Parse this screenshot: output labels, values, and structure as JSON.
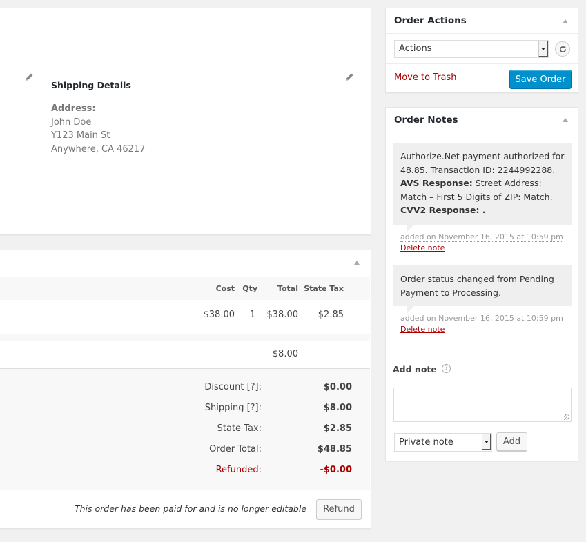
{
  "order_data": {
    "shipping": {
      "title": "Shipping Details",
      "address_label": "Address:",
      "address_lines": [
        "John Doe",
        "Y123 Main St",
        "Anywhere, CA 46217"
      ]
    }
  },
  "items": {
    "columns": [
      "Cost",
      "Qty",
      "Total",
      "State Tax"
    ],
    "line_items": [
      {
        "cost": "$38.00",
        "qty": "1",
        "total": "$38.00",
        "tax": "$2.85"
      }
    ],
    "shipping_line": {
      "total": "$8.00",
      "tax": "–"
    },
    "totals": [
      {
        "label": "Discount [?]:",
        "value": "$0.00"
      },
      {
        "label": "Shipping [?]:",
        "value": "$8.00"
      },
      {
        "label": "State Tax:",
        "value": "$2.85"
      },
      {
        "label": "Order Total:",
        "value": "$48.85"
      },
      {
        "label": "Refunded:",
        "value": "-$0.00"
      }
    ],
    "paid_note": "This order has been paid for and is no longer editable",
    "refund_label": "Refund"
  },
  "order_actions": {
    "title": "Order Actions",
    "select_value": "Actions",
    "move_to_trash": "Move to Trash",
    "save_label": "Save Order"
  },
  "order_notes": {
    "title": "Order Notes",
    "notes": [
      {
        "line1": "Authorize.Net payment authorized for 48.85. Transaction ID: 2244992288.",
        "avs_label": "AVS Response:",
        "avs_value": " Street Address: Match – First 5 Digits of ZIP: Match.",
        "cvv_label": "CVV2 Response: .",
        "date": "added on November 16, 2015 at 10:59 pm",
        "delete": "Delete note"
      },
      {
        "text": "Order status changed from Pending Payment to Processing.",
        "date": "added on November 16, 2015 at 10:59 pm",
        "delete": "Delete note"
      }
    ],
    "add_note_label": "Add note",
    "help_glyph": "?",
    "note_type_value": "Private note",
    "add_label": "Add"
  },
  "colors": {
    "primary_button": "#0091cd",
    "danger": "#aa0000",
    "background": "#f1f1f1"
  }
}
